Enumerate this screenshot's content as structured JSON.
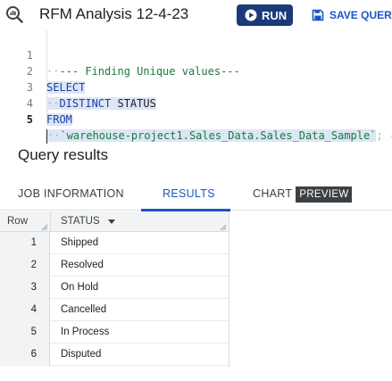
{
  "header": {
    "title": "RFM Analysis 12-4-23",
    "run_label": "RUN",
    "save_label": "SAVE QUERY"
  },
  "editor": {
    "active_line": 5,
    "lines": [
      {
        "num": "1",
        "text": "--- Finding Unique values---"
      },
      {
        "num": "2",
        "text": "SELECT"
      },
      {
        "num": "3",
        "keyword": "DISTINCT",
        "text": "STATUS"
      },
      {
        "num": "4",
        "text": "FROM"
      },
      {
        "num": "5",
        "text": "`warehouse-project1.Sales_Data.Sales_Data_Sample`",
        "suffix": "; -"
      }
    ]
  },
  "results": {
    "title": "Query results",
    "tabs": [
      {
        "label": "JOB INFORMATION",
        "active": false
      },
      {
        "label": "RESULTS",
        "active": true
      },
      {
        "label": "CHART",
        "badge": "PREVIEW",
        "active": false
      }
    ],
    "columns": [
      "Row",
      "STATUS"
    ],
    "rows": [
      {
        "row": "1",
        "status": "Shipped"
      },
      {
        "row": "2",
        "status": "Resolved"
      },
      {
        "row": "3",
        "status": "On Hold"
      },
      {
        "row": "4",
        "status": "Cancelled"
      },
      {
        "row": "5",
        "status": "In Process"
      },
      {
        "row": "6",
        "status": "Disputed"
      }
    ]
  },
  "colors": {
    "run_button": "#1a3a7a",
    "accent": "#1a55c8",
    "keyword": "#1a3fa8",
    "comment": "#1a7a3a"
  }
}
